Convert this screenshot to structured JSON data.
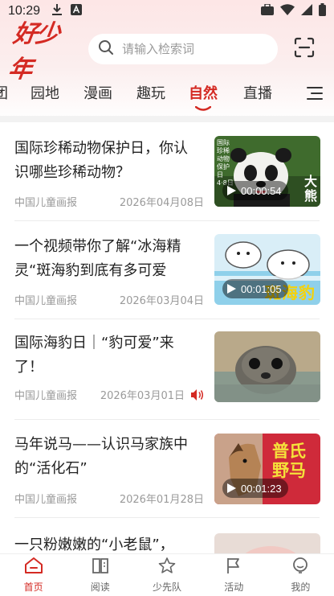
{
  "status_bar": {
    "time": "10:29",
    "icons": [
      "download-icon",
      "font-a-icon",
      "briefcase-icon",
      "wifi-icon",
      "signal-icon",
      "battery-icon"
    ]
  },
  "header": {
    "logo_text": "好少年",
    "search_placeholder": "请输入检索词",
    "icons": [
      "search-icon",
      "scan-icon"
    ],
    "brand_color": "#d42a23"
  },
  "tabs": {
    "items": [
      "园地",
      "漫画",
      "趣玩",
      "自然",
      "直播"
    ],
    "partial_left": "团",
    "active_index": 3,
    "menu_icon": "menu-icon"
  },
  "feed": {
    "items": [
      {
        "title": "国际珍稀动物保护日，你认识哪些珍稀动物？",
        "source": "中国儿童画报",
        "date": "2026年04月08日",
        "duration": "00:00:54",
        "thumb_caption": "大熊",
        "thumb_label_small": "国际珍稀动物保护日 4·8日"
      },
      {
        "title": "一个视频带你了解“冰海精灵“斑海豹到底有多可爱",
        "source": "中国儿童画报",
        "date": "2026年03月04日",
        "duration": "00:01:05",
        "thumb_caption": "斑海豹"
      },
      {
        "title": "国际海豹日｜“豹可爱”来了！",
        "source": "中国儿童画报",
        "date": "2026年03月01日",
        "audio_icon": "speaker-icon"
      },
      {
        "title": "马年说马——认识马家族中的“活化石”",
        "source": "中国儿童画报",
        "date": "2026年01月28日",
        "duration": "00:01:23",
        "thumb_caption": "普氏野马"
      },
      {
        "title": "一只粉嫩嫩的“小老鼠”，"
      }
    ]
  },
  "tabbar": {
    "items": [
      {
        "label": "首页",
        "icon": "home-icon"
      },
      {
        "label": "阅读",
        "icon": "book-icon"
      },
      {
        "label": "少先队",
        "icon": "star-badge-icon"
      },
      {
        "label": "活动",
        "icon": "flag-icon"
      },
      {
        "label": "我的",
        "icon": "profile-icon"
      }
    ],
    "active_index": 0
  }
}
